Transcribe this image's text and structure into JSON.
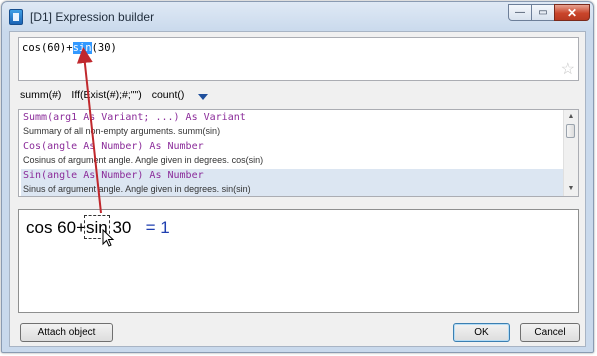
{
  "window": {
    "title": "[D1] Expression builder",
    "buttons": {
      "minimize": "—",
      "maximize": "▭",
      "close": "✕"
    }
  },
  "expression": {
    "before": "cos(60)+",
    "selected": "sin",
    "after": "(30)",
    "favorite_icon": "star-icon"
  },
  "functions_bar": {
    "items": [
      "summ(#)",
      "Iff(Exist(#);#;\"\")",
      "count()"
    ],
    "more_icon": "dropdown-triangle-icon"
  },
  "function_list": [
    {
      "signature": "Summ(arg1 As Variant; ...) As Variant",
      "description": "Summary of all non-empty arguments. summ(sin)"
    },
    {
      "signature": "Cos(angle As Number) As Number",
      "description": "Cosinus of argument angle. Angle given in degrees. cos(sin)"
    },
    {
      "signature": "Sin(angle As Number) As Number",
      "description": "Sinus of argument angle. Angle given in degrees. sin(sin)"
    }
  ],
  "preview": {
    "before": "cos 60+",
    "highlight": "sin",
    "after": " 30",
    "result": "= 1"
  },
  "footer": {
    "attach": "Attach object",
    "ok": "OK",
    "cancel": "Cancel"
  },
  "colors": {
    "selection": "#3399ff",
    "signature": "#8b2c9a",
    "result": "#1f3fb0",
    "arrow": "#c0282d"
  }
}
